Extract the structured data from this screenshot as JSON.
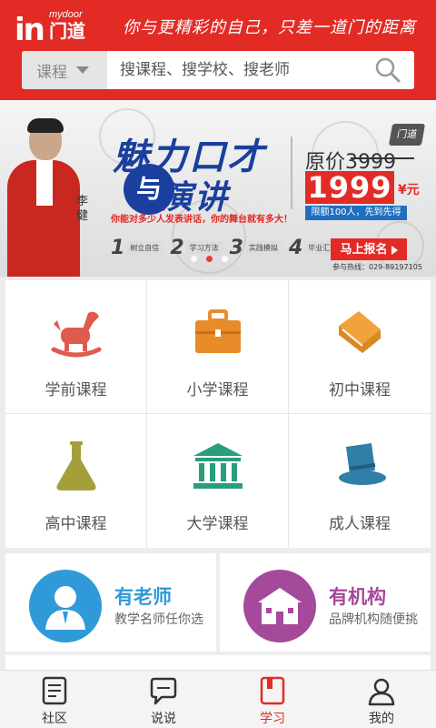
{
  "header": {
    "logo_mark": "in",
    "logo_en": "mydoor",
    "logo_cn": "门道",
    "slogan": "你与更精彩的自己，只差一道门的距离",
    "search": {
      "category": "课程",
      "placeholder": "搜课程、搜学校、搜老师"
    }
  },
  "banner": {
    "presenter_name": "李健",
    "title_line1": "魅力口才",
    "title_mid": "与",
    "title_line2": "演讲",
    "subtitle": "你能对多少人发表讲话，你的舞台就有多大！",
    "steps": [
      {
        "num": "1",
        "text": "树立自信"
      },
      {
        "num": "2",
        "text": "学习方法"
      },
      {
        "num": "3",
        "text": "实践模拟"
      },
      {
        "num": "4",
        "text": "毕业汇演"
      }
    ],
    "badge": "门道",
    "original_price": "原价3999",
    "price": "1999",
    "price_unit": "¥元",
    "limit": "限额100人，先到先得",
    "signup": "马上报名",
    "hotline": "参与热线：029-89197105",
    "slide_count": 3,
    "active_slide": 1
  },
  "courses": [
    {
      "label": "学前课程",
      "icon": "rocking-horse-icon",
      "color": "#e05a4e"
    },
    {
      "label": "小学课程",
      "icon": "briefcase-icon",
      "color": "#e88c2a"
    },
    {
      "label": "初中课程",
      "icon": "books-icon",
      "color": "#f2a23a"
    },
    {
      "label": "高中课程",
      "icon": "flask-icon",
      "color": "#a3a03c"
    },
    {
      "label": "大学课程",
      "icon": "university-icon",
      "color": "#2a9d7f"
    },
    {
      "label": "成人课程",
      "icon": "top-hat-icon",
      "color": "#2f7fa8"
    }
  ],
  "cards": [
    {
      "title": "有老师",
      "subtitle": "教学名师任你选",
      "color": "#2f9ad8",
      "icon": "teacher-icon"
    },
    {
      "title": "有机构",
      "subtitle": "品牌机构随便挑",
      "color": "#a5499a",
      "icon": "institution-icon"
    }
  ],
  "tabs": [
    {
      "label": "社区",
      "icon": "community-icon",
      "active": false
    },
    {
      "label": "说说",
      "icon": "chat-icon",
      "active": false
    },
    {
      "label": "学习",
      "icon": "study-icon",
      "active": true
    },
    {
      "label": "我的",
      "icon": "profile-icon",
      "active": false
    }
  ],
  "colors": {
    "brand_red": "#e32b26",
    "blue": "#1a3f9e",
    "teacher_blue": "#2f9ad8",
    "institution_purple": "#a5499a"
  }
}
